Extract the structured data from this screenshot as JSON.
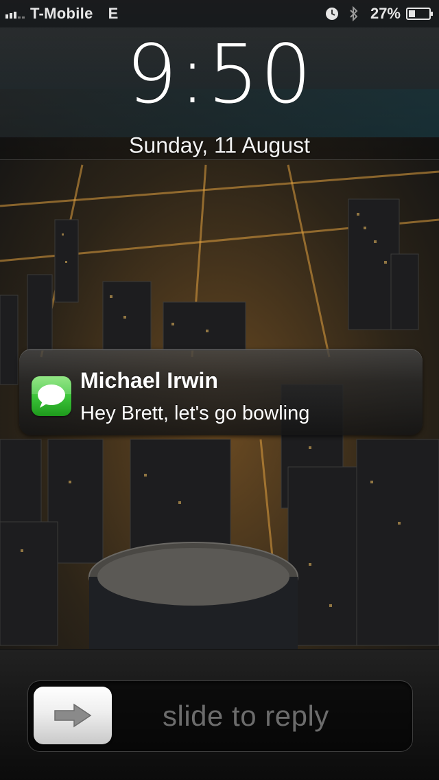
{
  "status_bar": {
    "carrier": "T-Mobile",
    "network": "E",
    "battery_percent": "27%",
    "icons": [
      "signal-bars-icon",
      "clock-icon",
      "bluetooth-icon",
      "battery-icon"
    ]
  },
  "lock_screen": {
    "time": "9:50",
    "date": "Sunday, 11 August"
  },
  "notification": {
    "app_icon": "messages-icon",
    "sender": "Michael Irwin",
    "message": "Hey Brett, let's go bowling"
  },
  "slider": {
    "label": "slide to reply",
    "knob_icon": "arrow-right-icon"
  },
  "colors": {
    "messages_green": "#3cc53a",
    "text_white": "#ffffff",
    "slider_text_gray": "#787878"
  }
}
